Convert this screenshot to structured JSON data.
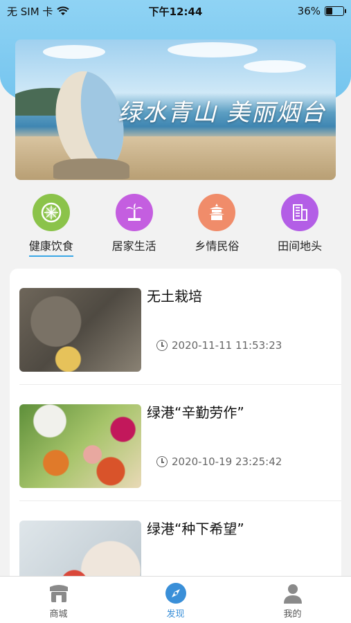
{
  "status_bar": {
    "carrier": "无 SIM 卡",
    "time": "下午12:44",
    "battery": "36%",
    "battery_level": 0.36
  },
  "banner": {
    "headline": "绿水青山 美丽烟台"
  },
  "categories": [
    {
      "label": "健康饮食",
      "icon": "lime-icon",
      "color": "#8bc34a",
      "active": true
    },
    {
      "label": "居家生活",
      "icon": "palm-tree-icon",
      "color": "#c45ee0",
      "active": false
    },
    {
      "label": "乡情民俗",
      "icon": "temple-icon",
      "color": "#f08c6a",
      "active": false
    },
    {
      "label": "田间地头",
      "icon": "building-icon",
      "color": "#b35ee6",
      "active": false
    }
  ],
  "articles": [
    {
      "title": "无土栽培",
      "time": "2020-11-11 11:53:23"
    },
    {
      "title": "绿港“辛勤劳作”",
      "time": "2020-10-19 23:25:42"
    },
    {
      "title": "绿港“种下希望”",
      "time": ""
    }
  ],
  "tabbar": [
    {
      "label": "商城",
      "icon": "shop-icon",
      "active": false
    },
    {
      "label": "发现",
      "icon": "compass-icon",
      "active": true
    },
    {
      "label": "我的",
      "icon": "user-icon",
      "active": false
    }
  ],
  "colors": {
    "accent": "#3aa7e6",
    "header_blue": "#8fd3f4"
  }
}
